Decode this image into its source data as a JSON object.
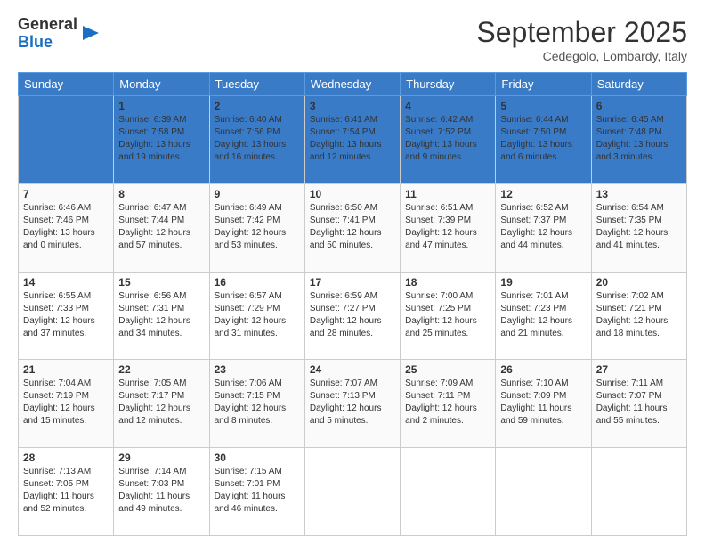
{
  "logo": {
    "general": "General",
    "blue": "Blue"
  },
  "header": {
    "month": "September 2025",
    "location": "Cedegolo, Lombardy, Italy"
  },
  "weekdays": [
    "Sunday",
    "Monday",
    "Tuesday",
    "Wednesday",
    "Thursday",
    "Friday",
    "Saturday"
  ],
  "weeks": [
    [
      {
        "day": "",
        "content": ""
      },
      {
        "day": "1",
        "content": "Sunrise: 6:39 AM\nSunset: 7:58 PM\nDaylight: 13 hours\nand 19 minutes."
      },
      {
        "day": "2",
        "content": "Sunrise: 6:40 AM\nSunset: 7:56 PM\nDaylight: 13 hours\nand 16 minutes."
      },
      {
        "day": "3",
        "content": "Sunrise: 6:41 AM\nSunset: 7:54 PM\nDaylight: 13 hours\nand 12 minutes."
      },
      {
        "day": "4",
        "content": "Sunrise: 6:42 AM\nSunset: 7:52 PM\nDaylight: 13 hours\nand 9 minutes."
      },
      {
        "day": "5",
        "content": "Sunrise: 6:44 AM\nSunset: 7:50 PM\nDaylight: 13 hours\nand 6 minutes."
      },
      {
        "day": "6",
        "content": "Sunrise: 6:45 AM\nSunset: 7:48 PM\nDaylight: 13 hours\nand 3 minutes."
      }
    ],
    [
      {
        "day": "7",
        "content": "Sunrise: 6:46 AM\nSunset: 7:46 PM\nDaylight: 13 hours\nand 0 minutes."
      },
      {
        "day": "8",
        "content": "Sunrise: 6:47 AM\nSunset: 7:44 PM\nDaylight: 12 hours\nand 57 minutes."
      },
      {
        "day": "9",
        "content": "Sunrise: 6:49 AM\nSunset: 7:42 PM\nDaylight: 12 hours\nand 53 minutes."
      },
      {
        "day": "10",
        "content": "Sunrise: 6:50 AM\nSunset: 7:41 PM\nDaylight: 12 hours\nand 50 minutes."
      },
      {
        "day": "11",
        "content": "Sunrise: 6:51 AM\nSunset: 7:39 PM\nDaylight: 12 hours\nand 47 minutes."
      },
      {
        "day": "12",
        "content": "Sunrise: 6:52 AM\nSunset: 7:37 PM\nDaylight: 12 hours\nand 44 minutes."
      },
      {
        "day": "13",
        "content": "Sunrise: 6:54 AM\nSunset: 7:35 PM\nDaylight: 12 hours\nand 41 minutes."
      }
    ],
    [
      {
        "day": "14",
        "content": "Sunrise: 6:55 AM\nSunset: 7:33 PM\nDaylight: 12 hours\nand 37 minutes."
      },
      {
        "day": "15",
        "content": "Sunrise: 6:56 AM\nSunset: 7:31 PM\nDaylight: 12 hours\nand 34 minutes."
      },
      {
        "day": "16",
        "content": "Sunrise: 6:57 AM\nSunset: 7:29 PM\nDaylight: 12 hours\nand 31 minutes."
      },
      {
        "day": "17",
        "content": "Sunrise: 6:59 AM\nSunset: 7:27 PM\nDaylight: 12 hours\nand 28 minutes."
      },
      {
        "day": "18",
        "content": "Sunrise: 7:00 AM\nSunset: 7:25 PM\nDaylight: 12 hours\nand 25 minutes."
      },
      {
        "day": "19",
        "content": "Sunrise: 7:01 AM\nSunset: 7:23 PM\nDaylight: 12 hours\nand 21 minutes."
      },
      {
        "day": "20",
        "content": "Sunrise: 7:02 AM\nSunset: 7:21 PM\nDaylight: 12 hours\nand 18 minutes."
      }
    ],
    [
      {
        "day": "21",
        "content": "Sunrise: 7:04 AM\nSunset: 7:19 PM\nDaylight: 12 hours\nand 15 minutes."
      },
      {
        "day": "22",
        "content": "Sunrise: 7:05 AM\nSunset: 7:17 PM\nDaylight: 12 hours\nand 12 minutes."
      },
      {
        "day": "23",
        "content": "Sunrise: 7:06 AM\nSunset: 7:15 PM\nDaylight: 12 hours\nand 8 minutes."
      },
      {
        "day": "24",
        "content": "Sunrise: 7:07 AM\nSunset: 7:13 PM\nDaylight: 12 hours\nand 5 minutes."
      },
      {
        "day": "25",
        "content": "Sunrise: 7:09 AM\nSunset: 7:11 PM\nDaylight: 12 hours\nand 2 minutes."
      },
      {
        "day": "26",
        "content": "Sunrise: 7:10 AM\nSunset: 7:09 PM\nDaylight: 11 hours\nand 59 minutes."
      },
      {
        "day": "27",
        "content": "Sunrise: 7:11 AM\nSunset: 7:07 PM\nDaylight: 11 hours\nand 55 minutes."
      }
    ],
    [
      {
        "day": "28",
        "content": "Sunrise: 7:13 AM\nSunset: 7:05 PM\nDaylight: 11 hours\nand 52 minutes."
      },
      {
        "day": "29",
        "content": "Sunrise: 7:14 AM\nSunset: 7:03 PM\nDaylight: 11 hours\nand 49 minutes."
      },
      {
        "day": "30",
        "content": "Sunrise: 7:15 AM\nSunset: 7:01 PM\nDaylight: 11 hours\nand 46 minutes."
      },
      {
        "day": "",
        "content": ""
      },
      {
        "day": "",
        "content": ""
      },
      {
        "day": "",
        "content": ""
      },
      {
        "day": "",
        "content": ""
      }
    ]
  ]
}
